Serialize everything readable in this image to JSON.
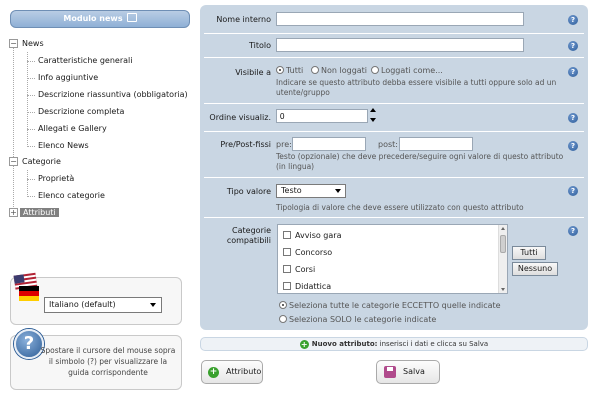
{
  "sidebar": {
    "header": "Modulo news",
    "tree": {
      "news": "News",
      "news_children": [
        "Caratteristiche generali",
        "Info aggiuntive",
        "Descrizione riassuntiva (obbligatoria)",
        "Descrizione completa",
        "Allegati e Gallery",
        "Elenco News"
      ],
      "categorie": "Categorie",
      "categorie_children": [
        "Proprietà",
        "Elenco categorie"
      ],
      "attributi": "Attributi"
    },
    "language": {
      "selected": "Italiano (default)"
    },
    "help": {
      "icon": "?",
      "text": "Spostare il cursore del mouse sopra il simbolo (?) per visualizzare la guida corrispondente"
    }
  },
  "form": {
    "nome_interno": {
      "label": "Nome interno",
      "value": ""
    },
    "titolo": {
      "label": "Titolo",
      "value": ""
    },
    "visibile": {
      "label": "Visibile a",
      "options": [
        "Tutti",
        "Non loggati",
        "Loggati come..."
      ],
      "selected": "Tutti",
      "hint": "Indicare se questo attributo debba essere visibile a tutti oppure solo ad un utente/gruppo"
    },
    "ordine": {
      "label": "Ordine visualiz.",
      "value": "0"
    },
    "prepost": {
      "label": "Pre/Post-fissi",
      "pre_label": "pre:",
      "post_label": "post:",
      "hint": "Testo (opzionale) che deve precedere/seguire ogni valore di questo attributo (in lingua)"
    },
    "tipo": {
      "label": "Tipo valore",
      "value": "Testo",
      "hint": "Tipologia di valore che deve essere utilizzato con questo attributo"
    },
    "categorie": {
      "label_line1": "Categorie",
      "label_line2": "compatibili",
      "items": [
        "Avviso gara",
        "Concorso",
        "Corsi",
        "Didattica"
      ],
      "btn_all": "Tutti",
      "btn_none": "Nessuno",
      "mode_options": [
        "Seleziona tutte le categorie ECCETTO quelle indicate",
        "Seleziona SOLO le categorie indicate"
      ],
      "mode_selected": 0
    },
    "help_icon": "?"
  },
  "notice": {
    "bold": "Nuovo attributo:",
    "text": " inserisci i dati e clicca su Salva"
  },
  "buttons": {
    "attributo": "Attributo",
    "salva": "Salva"
  }
}
